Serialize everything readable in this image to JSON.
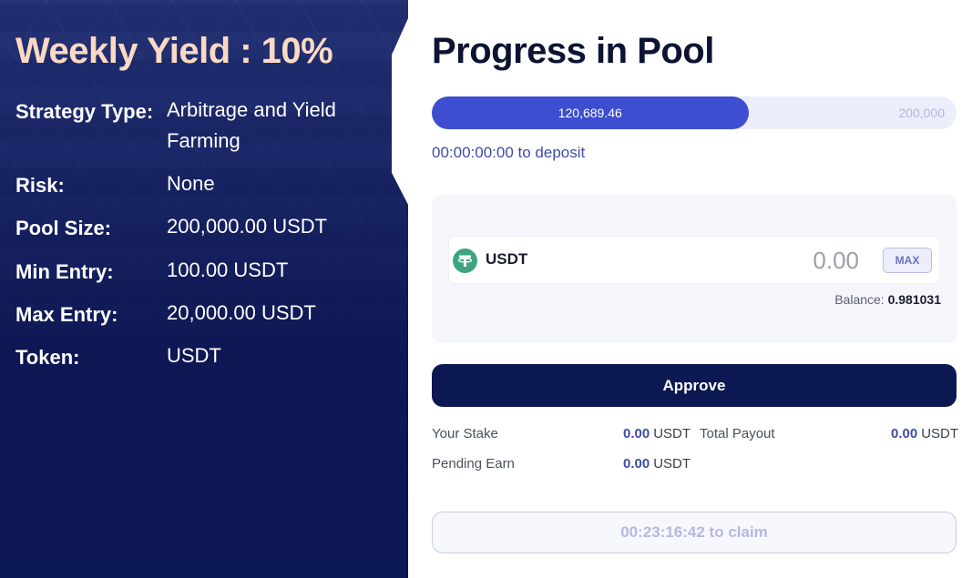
{
  "pool_info": {
    "title": "Weekly Yield : 10%",
    "rows": [
      {
        "label": "Strategy Type:",
        "value": "Arbitrage and Yield Farming"
      },
      {
        "label": "Risk:",
        "value": "None"
      },
      {
        "label": "Pool Size:",
        "value": "200,000.00 USDT"
      },
      {
        "label": "Min Entry:",
        "value": "100.00 USDT"
      },
      {
        "label": "Max Entry:",
        "value": "20,000.00 USDT"
      },
      {
        "label": "Token:",
        "value": "USDT"
      }
    ]
  },
  "progress": {
    "title": "Progress in Pool",
    "current": "120,689.46",
    "max": "200,000",
    "fraction": 0.6034,
    "deposit_timer": "00:00:00:00 to deposit"
  },
  "stake_form": {
    "token_icon": "tether-icon",
    "token_symbol": "USDT",
    "amount_placeholder": "0.00",
    "max_label": "MAX",
    "balance_label": "Balance:",
    "balance_value": "0.981031"
  },
  "approve_label": "Approve",
  "stats": {
    "your_stake_label": "Your Stake",
    "your_stake_value": "0.00",
    "your_stake_unit": "USDT",
    "total_payout_label": "Total Payout",
    "total_payout_value": "0.00",
    "total_payout_unit": "USDT",
    "pending_earn_label": "Pending Earn",
    "pending_earn_value": "0.00",
    "pending_earn_unit": "USDT"
  },
  "claim_label": "00:23:16:42 to claim",
  "colors": {
    "accent": "#3d4ed0",
    "navy": "#0b1851",
    "title_peach": "#fbd9c3",
    "tether_green": "#3fa382"
  }
}
